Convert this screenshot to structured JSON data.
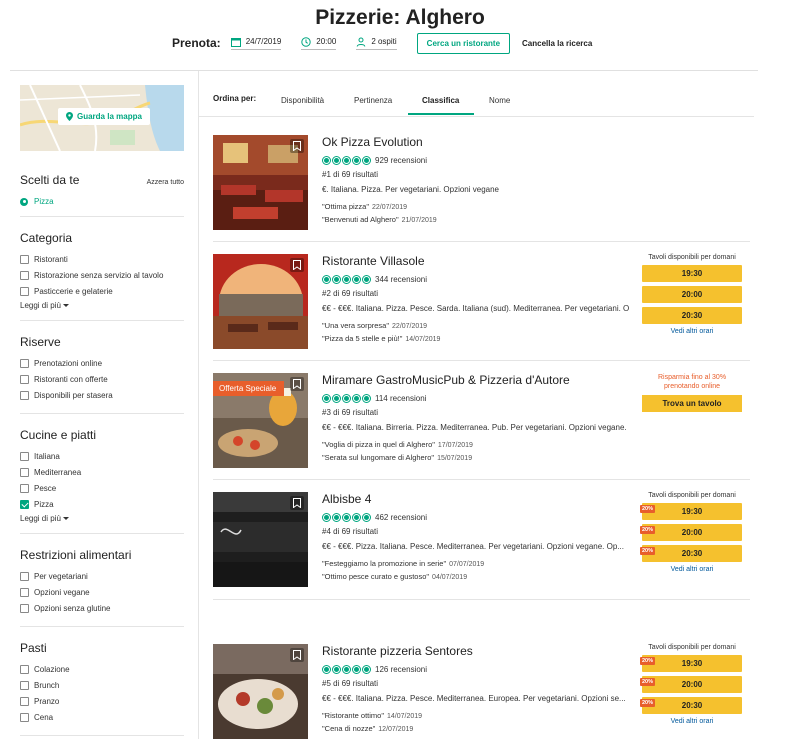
{
  "page": {
    "title": "Pizzerie: Alghero"
  },
  "reservation": {
    "label": "Prenota:",
    "date": "24/7/2019",
    "time": "20:00",
    "guests": "2 ospiti",
    "search_button": "Cerca un ristorante",
    "cancel_link": "Cancella la ricerca"
  },
  "sidebar": {
    "map_button": "Guarda la mappa",
    "chosen": {
      "title": "Scelti da te",
      "reset": "Azzera tutto",
      "items": [
        "Pizza"
      ]
    },
    "sections": [
      {
        "title": "Categoria",
        "options": [
          {
            "label": "Ristoranti",
            "checked": false
          },
          {
            "label": "Ristorazione senza servizio al tavolo",
            "checked": false
          },
          {
            "label": "Pasticcerie e gelaterie",
            "checked": false
          }
        ],
        "more": "Leggi di più"
      },
      {
        "title": "Riserve",
        "options": [
          {
            "label": "Prenotazioni online",
            "checked": false
          },
          {
            "label": "Ristoranti con offerte",
            "checked": false
          },
          {
            "label": "Disponibili per stasera",
            "checked": false
          }
        ]
      },
      {
        "title": "Cucine e piatti",
        "options": [
          {
            "label": "Italiana",
            "checked": false
          },
          {
            "label": "Mediterranea",
            "checked": false
          },
          {
            "label": "Pesce",
            "checked": false
          },
          {
            "label": "Pizza",
            "checked": true
          }
        ],
        "more": "Leggi di più"
      },
      {
        "title": "Restrizioni alimentari",
        "options": [
          {
            "label": "Per vegetariani",
            "checked": false
          },
          {
            "label": "Opzioni vegane",
            "checked": false
          },
          {
            "label": "Opzioni senza glutine",
            "checked": false
          }
        ]
      },
      {
        "title": "Pasti",
        "options": [
          {
            "label": "Colazione",
            "checked": false
          },
          {
            "label": "Brunch",
            "checked": false
          },
          {
            "label": "Pranzo",
            "checked": false
          },
          {
            "label": "Cena",
            "checked": false
          }
        ]
      }
    ]
  },
  "sort": {
    "label": "Ordina per:",
    "tabs": [
      "Disponibilità",
      "Pertinenza",
      "Classifica",
      "Nome"
    ],
    "active": "Classifica"
  },
  "results": [
    {
      "name": "Ok Pizza Evolution",
      "reviews": "929 recensioni",
      "rank": "#1 di 69 risultati",
      "cuisine": "€. Italiana. Pizza. Per vegetariani. Opzioni vegane",
      "quotes": [
        {
          "text": "\"Ottima pizza\"",
          "date": "22/07/2019"
        },
        {
          "text": "\"Benvenuti ad Alghero\"",
          "date": "21/07/2019"
        }
      ],
      "offer": null
    },
    {
      "name": "Ristorante Villasole",
      "reviews": "344 recensioni",
      "rank": "#2 di 69 risultati",
      "cuisine": "€€ - €€€. Italiana. Pizza. Pesce. Sarda. Italiana (sud). Mediterranea. Per vegetariani. O",
      "quotes": [
        {
          "text": "\"Una vera sorpresa\"",
          "date": "22/07/2019"
        },
        {
          "text": "\"Pizza da 5 stelle e più!\"",
          "date": "14/07/2019"
        }
      ],
      "availability": {
        "title": "Tavoli disponibili per domani",
        "slots": [
          {
            "time": "19:30",
            "badge": ""
          },
          {
            "time": "20:00",
            "badge": ""
          },
          {
            "time": "20:30",
            "badge": ""
          }
        ],
        "more": "Vedi altri orari"
      }
    },
    {
      "name": "Miramare GastroMusicPub & Pizzeria d'Autore",
      "reviews": "114 recensioni",
      "rank": "#3 di 69 risultati",
      "cuisine": "€€ - €€€. Italiana. Birreria. Pizza. Mediterranea. Pub. Per vegetariani. Opzioni vegane.",
      "quotes": [
        {
          "text": "\"Voglia di pizza in quel di Alghero\"",
          "date": "17/07/2019"
        },
        {
          "text": "\"Serata sul lungomare di Alghero\"",
          "date": "15/07/2019"
        }
      ],
      "offer": "Offerta Speciale",
      "promo": {
        "line1": "Risparmia fino al 30%",
        "line2": "prenotando online",
        "button": "Trova un tavolo"
      }
    },
    {
      "name": "Albisbe 4",
      "reviews": "462 recensioni",
      "rank": "#4 di 69 risultati",
      "cuisine": "€€ - €€€. Pizza. Italiana. Pesce. Mediterranea. Per vegetariani. Opzioni vegane. Op...",
      "quotes": [
        {
          "text": "\"Festeggiamo la promozione in serie\"",
          "date": "07/07/2019"
        },
        {
          "text": "\"Ottimo pesce curato e gustoso\"",
          "date": "04/07/2019"
        }
      ],
      "availability": {
        "title": "Tavoli disponibili per domani",
        "slots": [
          {
            "time": "19:30",
            "badge": "20%"
          },
          {
            "time": "20:00",
            "badge": "20%"
          },
          {
            "time": "20:30",
            "badge": "20%"
          }
        ],
        "more": "Vedi altri orari"
      }
    },
    {
      "name": "Ristorante pizzeria Sentores",
      "reviews": "126 recensioni",
      "rank": "#5 di 69 risultati",
      "cuisine": "€€ - €€€. Italiana. Pizza. Pesce. Mediterranea. Europea. Per vegetariani. Opzioni se...",
      "quotes": [
        {
          "text": "\"Ristorante ottimo\"",
          "date": "14/07/2019"
        },
        {
          "text": "\"Cena di nozze\"",
          "date": "12/07/2019"
        }
      ],
      "availability": {
        "title": "Tavoli disponibili per domani",
        "slots": [
          {
            "time": "19:30",
            "badge": "20%"
          },
          {
            "time": "20:00",
            "badge": "20%"
          },
          {
            "time": "20:30",
            "badge": "20%"
          }
        ],
        "more": "Vedi altri orari"
      }
    }
  ]
}
